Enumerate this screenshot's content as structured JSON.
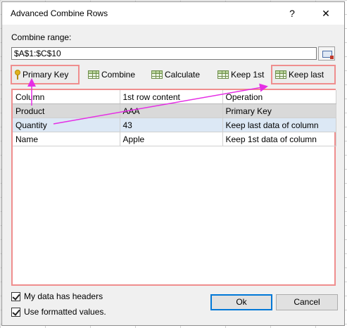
{
  "window": {
    "title": "Advanced Combine Rows",
    "help_label": "?",
    "close_label": "✕"
  },
  "range": {
    "label": "Combine range:",
    "value": "$A$1:$C$10"
  },
  "toolbar": {
    "primary_key": "Primary Key",
    "combine": "Combine",
    "calculate": "Calculate",
    "keep_first": "Keep 1st",
    "keep_last": "Keep last"
  },
  "grid": {
    "headers": [
      "Column",
      "1st row content",
      "Operation"
    ],
    "rows": [
      [
        "Product",
        "AAA",
        "Primary Key"
      ],
      [
        "Quantity",
        "43",
        "Keep last data of column"
      ],
      [
        "Name",
        "Apple",
        "Keep 1st data of column"
      ]
    ]
  },
  "options": {
    "headers": {
      "label": "My data has headers",
      "checked": true
    },
    "formatted": {
      "label": "Use formatted values.",
      "checked": true
    }
  },
  "buttons": {
    "ok": "Ok",
    "cancel": "Cancel"
  },
  "colors": {
    "highlight": "#ef8e8e",
    "arrow": "#e52ee5",
    "selected_row": "#dce8f5",
    "key_row": "#d9d9d9",
    "accent": "#0078d7"
  }
}
